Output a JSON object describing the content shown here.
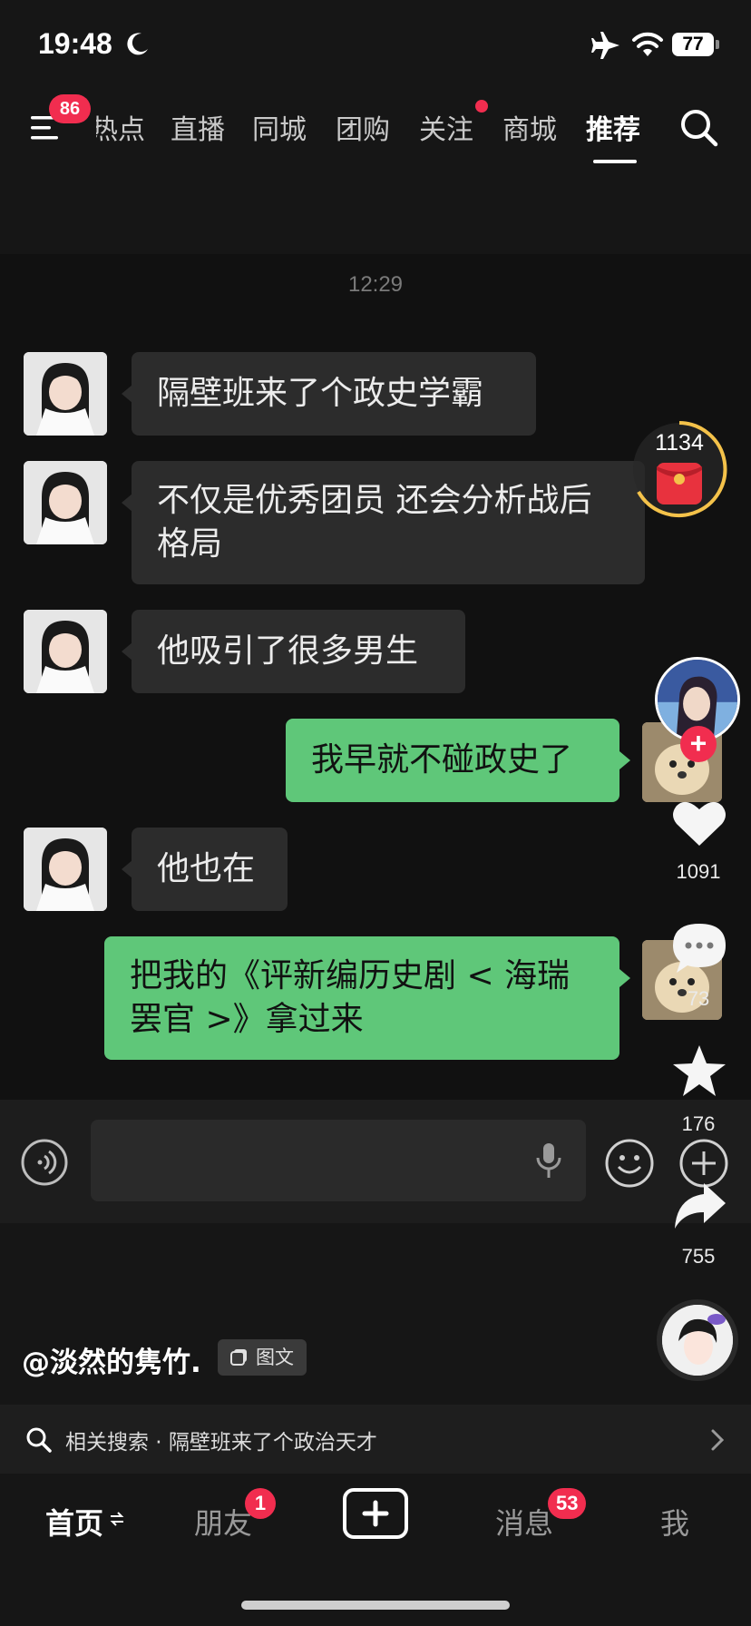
{
  "status_bar": {
    "time": "19:48",
    "battery": "77"
  },
  "top_nav": {
    "menu_badge": "86",
    "tabs": [
      "热点",
      "直播",
      "同城",
      "团购",
      "关注",
      "商城",
      "推荐"
    ],
    "active_tab": "推荐"
  },
  "chat": {
    "timestamp": "12:29",
    "messages": [
      {
        "side": "left",
        "lines": [
          "隔壁班来了个政史学霸"
        ]
      },
      {
        "side": "left",
        "lines": [
          "不仅是优秀团员 还会分析战后",
          "格局"
        ]
      },
      {
        "side": "left",
        "lines": [
          "他吸引了很多男生"
        ]
      },
      {
        "side": "right",
        "lines": [
          "我早就不碰政史了"
        ]
      },
      {
        "side": "left",
        "lines": [
          "他也在"
        ]
      },
      {
        "side": "right",
        "lines": [
          "把我的《评新编历史剧 < 海瑞",
          "罢官 >》拿过来"
        ]
      }
    ]
  },
  "right_rail": {
    "coin_count": "1134",
    "likes": "1091",
    "comments": "73",
    "favorites": "176",
    "shares": "755"
  },
  "caption": {
    "author": "@淡然的隽竹.",
    "type_tag": "图文"
  },
  "related_search": {
    "text": "相关搜索 · 隔壁班来了个政治天才"
  },
  "bottom_tabs": {
    "home": "首页",
    "friends": "朋友",
    "friends_badge": "1",
    "messages": "消息",
    "messages_badge": "53",
    "me": "我"
  },
  "colors": {
    "accent_red": "#f12d4f",
    "bubble_out": "#5fc779",
    "bubble_in": "#2c2c2c"
  }
}
